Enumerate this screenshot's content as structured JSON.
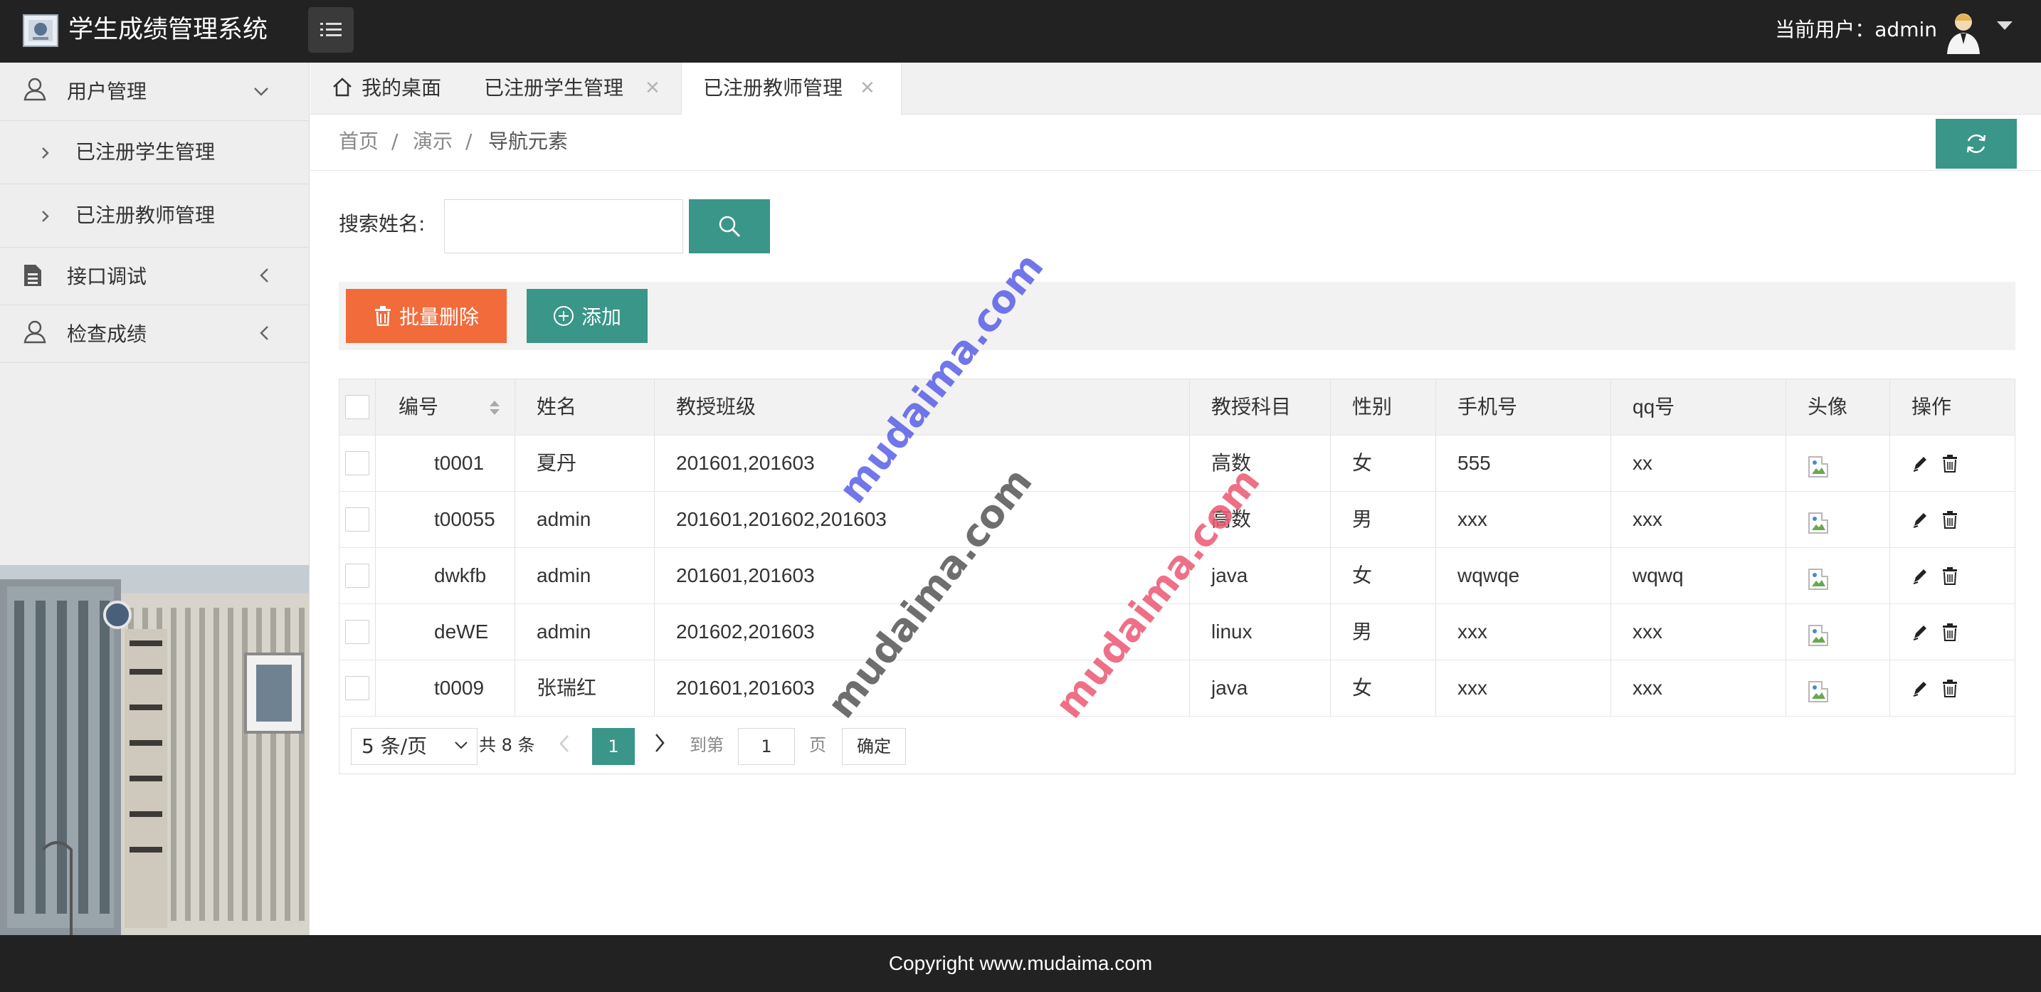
{
  "header": {
    "title": "学生成绩管理系统",
    "user_prefix": "当前用户：",
    "username": "admin"
  },
  "sidebar": {
    "menus": [
      {
        "label": "用户管理",
        "icon": "user-icon",
        "expanded": true,
        "children": [
          {
            "label": "已注册学生管理"
          },
          {
            "label": "已注册教师管理"
          }
        ]
      },
      {
        "label": "接口调试",
        "icon": "document-icon"
      },
      {
        "label": "检查成绩",
        "icon": "user-icon"
      }
    ]
  },
  "tabs": [
    {
      "label": "我的桌面",
      "icon": "home-icon"
    },
    {
      "label": "已注册学生管理",
      "closable": true
    },
    {
      "label": "已注册教师管理",
      "closable": true,
      "active": true
    }
  ],
  "breadcrumb": [
    "首页",
    "演示",
    "导航元素"
  ],
  "search": {
    "label": "搜索姓名:",
    "value": ""
  },
  "toolbar": {
    "batch_delete": "批量删除",
    "add": "添加"
  },
  "table": {
    "columns": [
      "编号",
      "姓名",
      "教授班级",
      "教授科目",
      "性别",
      "手机号",
      "qq号",
      "头像",
      "操作"
    ],
    "rows": [
      [
        "t0001",
        "夏丹",
        "201601,201603",
        "高数",
        "女",
        "555",
        "xx"
      ],
      [
        "t00055",
        "admin",
        "201601,201602,201603",
        "高数",
        "男",
        "xxx",
        "xxx"
      ],
      [
        "dwkfb",
        "admin",
        "201601,201603",
        "java",
        "女",
        "wqwqe",
        "wqwq"
      ],
      [
        "deWE",
        "admin",
        "201602,201603",
        "linux",
        "男",
        "xxx",
        "xxx"
      ],
      [
        "t0009",
        "张瑞红",
        "201601,201603",
        "java",
        "女",
        "xxx",
        "xxx"
      ]
    ]
  },
  "pager": {
    "page_size": "5 条/页",
    "total": "共 8 条",
    "current_page": "1",
    "goto_label": "到第",
    "goto_value": "1",
    "page_unit": "页",
    "confirm": "确定"
  },
  "watermarks": [
    "mudaima.com",
    "mudaima.com",
    "mudaima.com"
  ],
  "footer": {
    "copyright": "Copyright www.mudaima.com"
  },
  "colors": {
    "primary": "#3a9688",
    "danger": "#f26b3a",
    "header_bg": "#222222"
  }
}
